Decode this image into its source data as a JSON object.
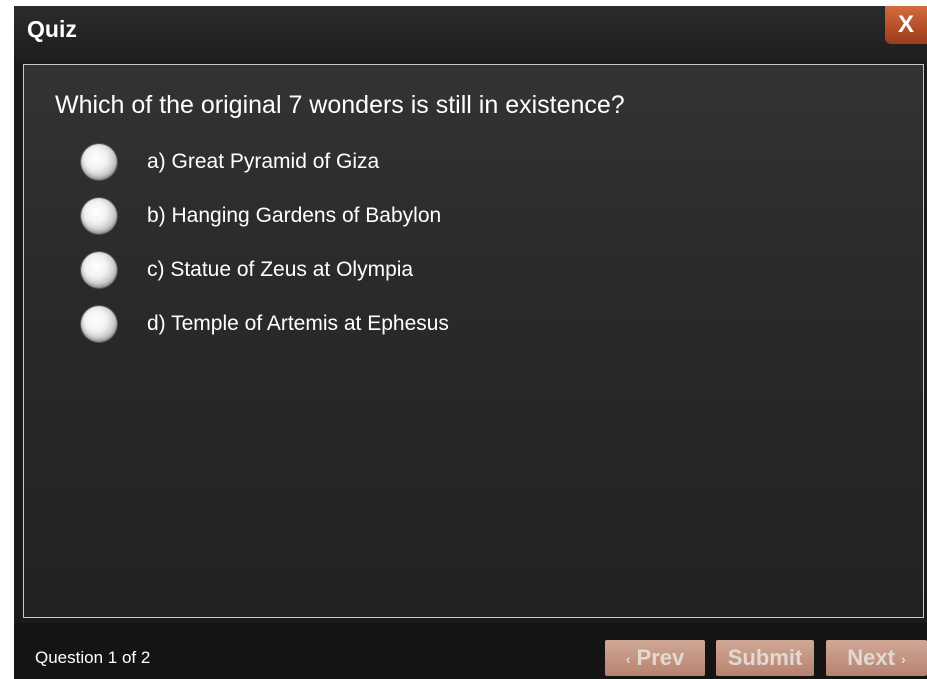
{
  "dialog": {
    "title": "Quiz",
    "close_label": "X"
  },
  "question": {
    "text": "Which of the original 7 wonders is still in existence?",
    "options": [
      {
        "label": "a) Great Pyramid of Giza",
        "selected": false
      },
      {
        "label": "b) Hanging Gardens of Babylon",
        "selected": false
      },
      {
        "label": "c) Statue of Zeus at Olympia",
        "selected": false
      },
      {
        "label": "d) Temple of Artemis at Ephesus",
        "selected": false
      }
    ]
  },
  "footer": {
    "counter": "Question 1 of 2",
    "prev_label": "Prev",
    "prev_chevron": "‹",
    "submit_label": "Submit",
    "next_label": "Next",
    "next_chevron": "›"
  },
  "colors": {
    "background": "#1a1a1a",
    "close_button": "#c0552a",
    "nav_button": "#d9a590",
    "text": "#ffffff"
  }
}
